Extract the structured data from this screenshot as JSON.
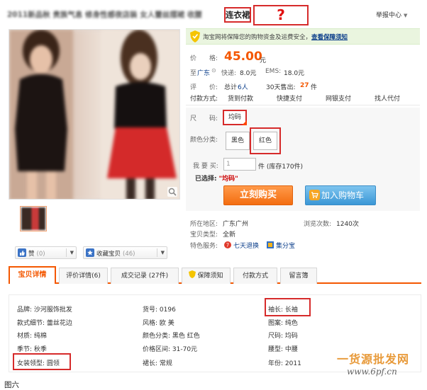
{
  "title": {
    "blurred_text": "2011新品秋 贵族气息 修身性感夜店装 女人蕾丝摆裙 收腰",
    "highlight_text": "连衣裙",
    "question_mark": "?"
  },
  "report_menu": {
    "label": "举报中心",
    "icon": "chevron-down-icon"
  },
  "gallery": {
    "zoom_icon": "magnifier-icon",
    "thumbnail_selected": true
  },
  "social": {
    "like_label": "赞",
    "like_count": "(0)",
    "fav_label": "收藏宝贝",
    "fav_count": "(46)"
  },
  "secure_bar": {
    "text": "淘宝网将保障您的购物资金及运费安全，",
    "link": "查看保障须知"
  },
  "info": {
    "price_label": "价　　格:",
    "price_value": "45.00",
    "price_unit": "元",
    "ship_to_label": "至",
    "ship_to_city": "广东",
    "express_label": "快递:",
    "express_value": "8.0元",
    "ems_label": "EMS:",
    "ems_value": "18.0元",
    "rating_label": "评　　价:",
    "rating_total_label": "总计",
    "rating_total_value": "6人",
    "sold_label": "30天售出:",
    "sold_value": "27",
    "sold_unit": "件",
    "pay_label": "付款方式:",
    "pay_methods": [
      "货到付款",
      "快捷支付",
      "网银支付",
      "找人代付"
    ]
  },
  "options": {
    "size_label": "尺　　码:",
    "size_value": "均码",
    "color_label": "颜色分类:",
    "color_black": "黑色",
    "color_red": "红色",
    "qty_label": "我 要 买:",
    "qty_value": "1",
    "qty_stock": "件 (库存170件)",
    "selected_label": "已选择:",
    "selected_value": "\"均码\"",
    "buy_button": "立刻购买",
    "cart_button": "加入购物车"
  },
  "extra": {
    "location_label": "所在地区:",
    "location_value": "广东广州",
    "views_label": "浏览次数:",
    "views_value": "1240次",
    "type_label": "宝贝类型:",
    "type_value": "全新",
    "service_label": "特色服务:",
    "service_1": "七天退换",
    "service_2": "集分宝"
  },
  "tabs": [
    {
      "label": "宝贝详情"
    },
    {
      "label": "评价详情(6)"
    },
    {
      "label": "成交记录 (27件)"
    },
    {
      "label": "保障须知"
    },
    {
      "label": "付款方式"
    },
    {
      "label": "留言簿"
    }
  ],
  "attributes": {
    "col1": [
      "品牌: 沙河服饰批发",
      "款式细节: 蕾丝花边",
      "材质: 纯棉",
      "季节: 秋季",
      "女装领型: 圆领"
    ],
    "col2": [
      "货号: 0196",
      "风格: 欧 美",
      "颜色分类: 黑色 红色",
      "价格区间: 31-70元",
      "裙长: 常规"
    ],
    "col3": [
      "袖长: 长袖",
      "图案: 纯色",
      "尺码: 均码",
      "腰型: 中腰",
      "年份: 2011"
    ]
  },
  "watermark": {
    "brand": "一货源批发网",
    "url": "www.6pf.cn"
  },
  "caption": "图六",
  "colors": {
    "accent_orange": "#f45700",
    "highlight_red": "#d62b2b",
    "link_blue": "#0a3d8a",
    "secure_green_bg": "#eaf5df"
  }
}
